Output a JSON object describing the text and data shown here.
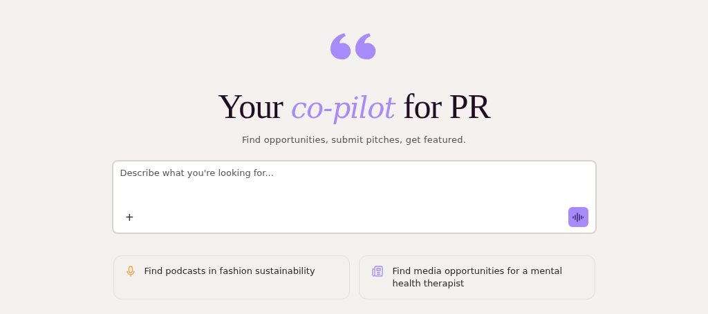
{
  "heading": "Your *co-pilot* for PR",
  "subtitle": "Find opportunities, submit pitches, get featured.",
  "prompt": {
    "placeholder": "Describe what you're looking for...",
    "add_symbol": "+"
  },
  "suggestions": [
    {
      "kind": "microphone",
      "label": "Find podcasts in fashion sustainability"
    },
    {
      "kind": "newspaper",
      "label": "Find media opportunities for a mental health therapist"
    }
  ]
}
